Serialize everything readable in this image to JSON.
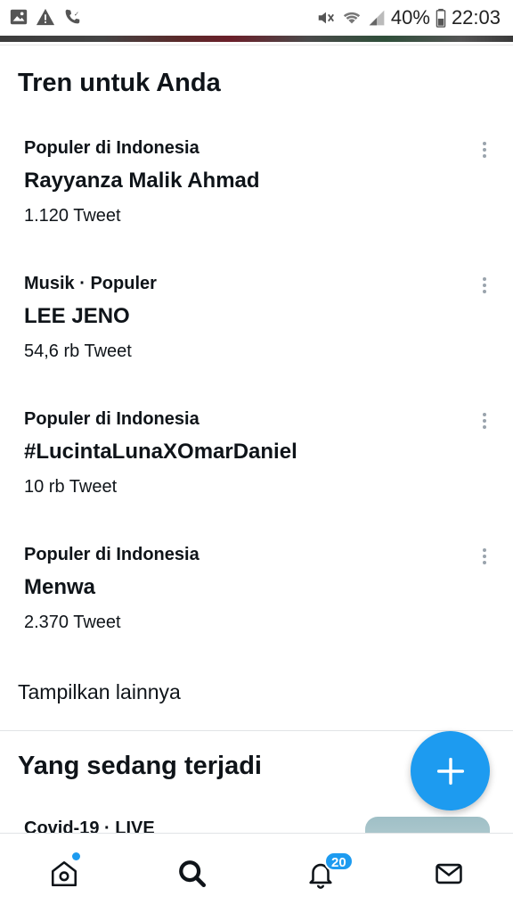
{
  "status_bar": {
    "battery": "40%",
    "time": "22:03",
    "left_icons": [
      "image-icon",
      "warning-icon",
      "wifi-call-icon"
    ],
    "right_icons": [
      "mute-icon",
      "wifi-icon",
      "signal-icon",
      "battery-icon"
    ]
  },
  "trends": {
    "title": "Tren untuk Anda",
    "items": [
      {
        "context": "Populer di Indonesia",
        "name": "Rayyanza Malik Ahmad",
        "count": "1.120 Tweet"
      },
      {
        "context": "Musik · Populer",
        "name": "LEE JENO",
        "count": "54,6 rb Tweet"
      },
      {
        "context": "Populer di Indonesia",
        "name": "#LucintaLunaXOmarDaniel",
        "count": "10 rb Tweet"
      },
      {
        "context": "Populer di Indonesia",
        "name": "Menwa",
        "count": "2.370 Tweet"
      }
    ],
    "show_more": "Tampilkan lainnya"
  },
  "happening": {
    "title": "Yang sedang terjadi",
    "peek_text": "Covid-19 · LIVE"
  },
  "bottom_nav": {
    "items": [
      "home-icon",
      "search-icon",
      "notifications-icon",
      "messages-icon"
    ],
    "notification_count": "20"
  },
  "colors": {
    "accent": "#1d9bf0",
    "text": "#0f1419",
    "muted": "#9aa4ad"
  }
}
